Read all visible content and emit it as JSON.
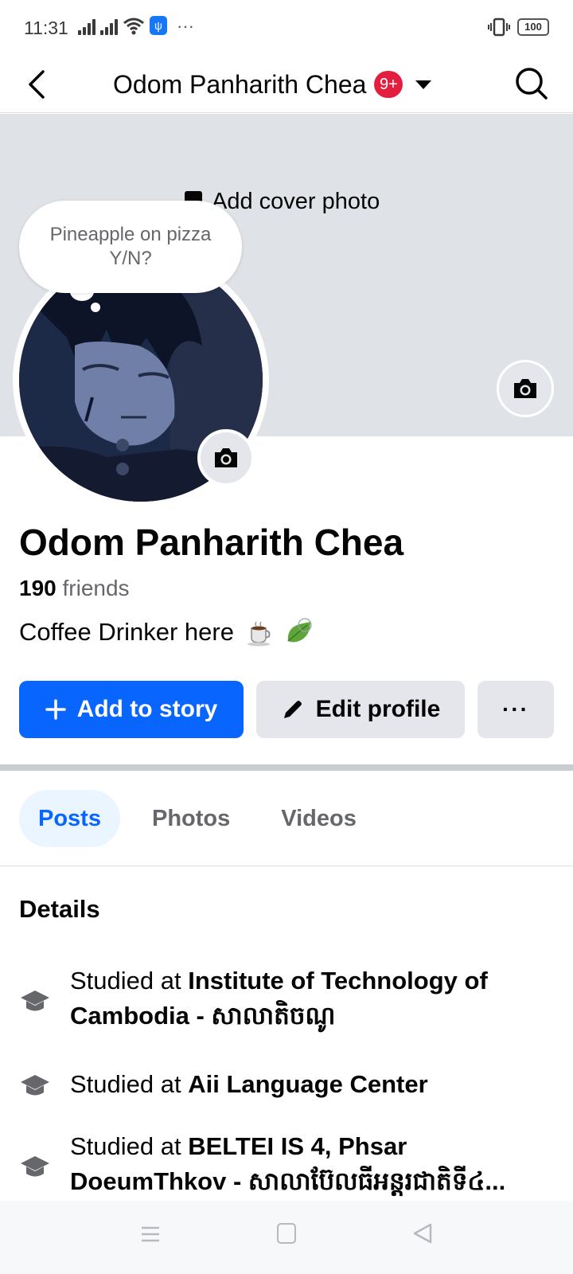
{
  "status_bar": {
    "time": "11:31",
    "more": "···",
    "battery": "100"
  },
  "header": {
    "title": "Odom Panharith Chea",
    "badge": "9+"
  },
  "cover": {
    "add_label": "Add cover photo"
  },
  "thought_bubble": {
    "text": "Pineapple on pizza Y/N?"
  },
  "profile": {
    "name": "Odom Panharith Chea",
    "friends_count": "190",
    "friends_label": " friends",
    "bio": "Coffee Drinker here"
  },
  "actions": {
    "add_story": "Add to story",
    "edit_profile": "Edit profile",
    "more": "···"
  },
  "tabs": [
    {
      "label": "Posts",
      "active": true
    },
    {
      "label": "Photos",
      "active": false
    },
    {
      "label": "Videos",
      "active": false
    }
  ],
  "details": {
    "heading": "Details",
    "items": [
      {
        "prefix": "Studied at ",
        "place": "Institute of Technology of Cambodia - សាលាតិចណូ",
        "icon": "graduation-cap-icon"
      },
      {
        "prefix": "Studied at ",
        "place": "Aii Language Center",
        "icon": "graduation-cap-icon"
      },
      {
        "prefix": "Studied at ",
        "place": "BELTEI IS 4, Phsar DoeumThkov - សាលាប៊ែលធីអន្តរជាតិទី៤...",
        "icon": "graduation-cap-icon"
      }
    ]
  },
  "colors": {
    "primary": "#0866ff",
    "badge": "#e41e3f",
    "cover": "#dfe2e6",
    "secondary_button": "#e4e6eb"
  }
}
